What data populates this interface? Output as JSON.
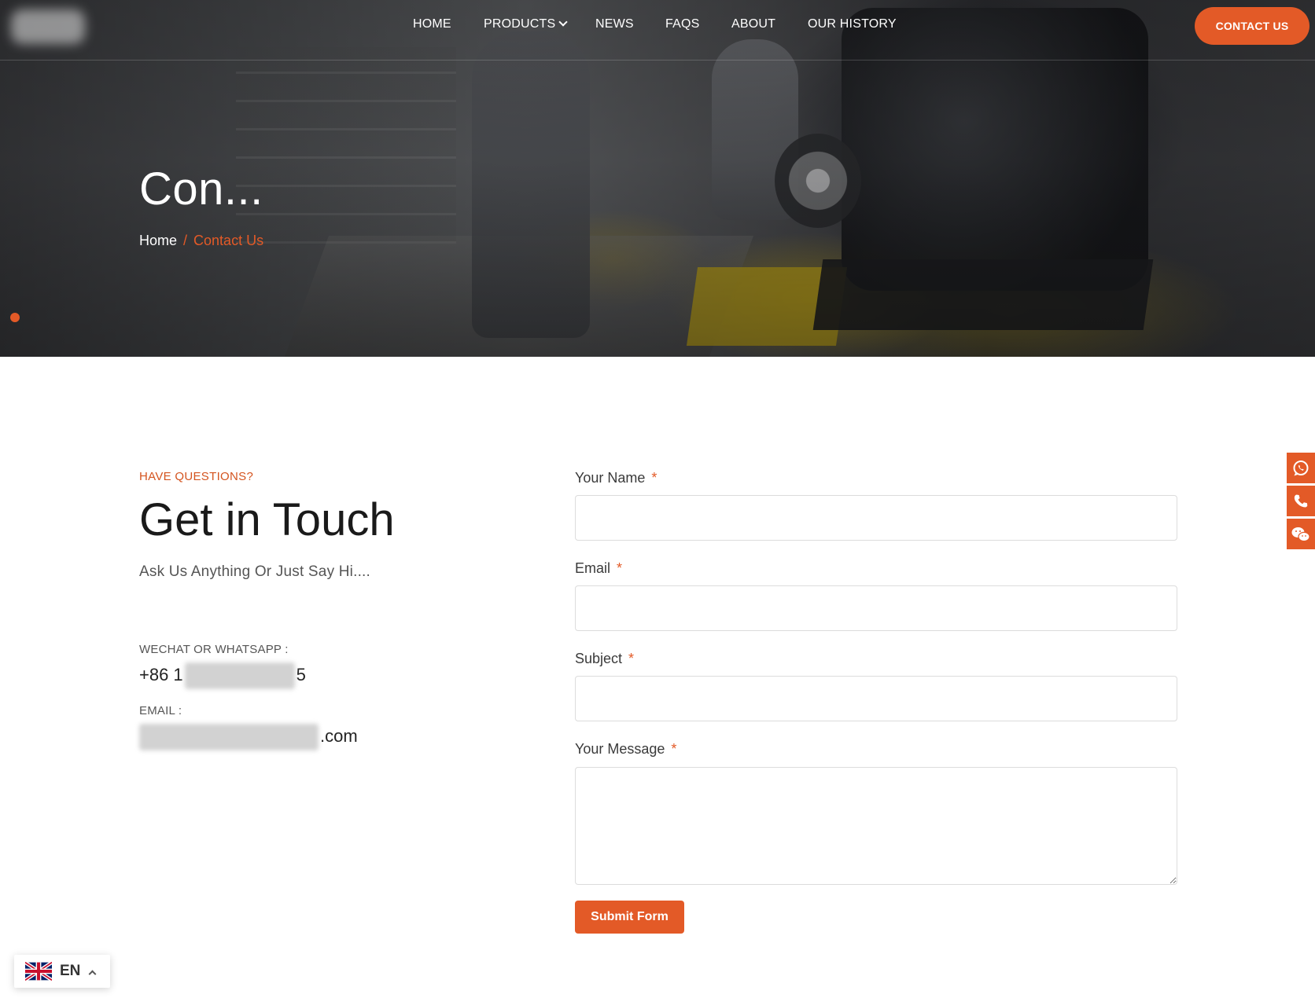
{
  "header": {
    "nav": [
      {
        "label": "HOME"
      },
      {
        "label": "PRODUCTS"
      },
      {
        "label": "NEWS"
      },
      {
        "label": "FAQS"
      },
      {
        "label": "ABOUT"
      },
      {
        "label": "OUR HISTORY"
      }
    ],
    "cta_label": "CONTACT US"
  },
  "hero": {
    "title": "Con...",
    "breadcrumb": {
      "home": "Home",
      "separator": "/",
      "current": "Contact Us"
    }
  },
  "contact": {
    "eyebrow": "HAVE QUESTIONS?",
    "heading": "Get in Touch",
    "subheading": "Ask Us Anything Or Just Say Hi....",
    "wechat_label": "WECHAT OR WHATSAPP :",
    "phone_prefix": "+86 1",
    "phone_suffix": "5",
    "email_label": "EMAIL :",
    "email_suffix": ".com"
  },
  "form": {
    "name_label": "Your Name",
    "email_label": "Email",
    "subject_label": "Subject",
    "message_label": "Your Message",
    "required_mark": "*",
    "name_value": "",
    "email_value": "",
    "subject_value": "",
    "message_value": "",
    "submit_label": "Submit Form"
  },
  "float_bar": {
    "icons": [
      "whatsapp-icon",
      "phone-icon",
      "wechat-icon"
    ]
  },
  "language": {
    "code": "EN",
    "flag": "uk-flag-icon"
  },
  "colors": {
    "accent": "#e35a27",
    "heading": "#1a1a1a",
    "text": "#555555"
  }
}
